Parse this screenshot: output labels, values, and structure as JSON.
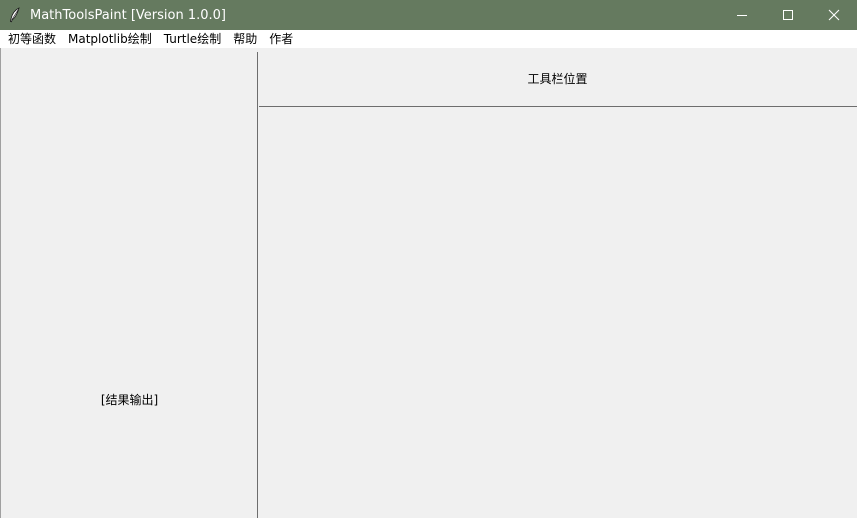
{
  "window": {
    "title": "MathToolsPaint [Version 1.0.0]",
    "app_icon": "feather-icon",
    "controls": {
      "minimize": "minimize-icon",
      "maximize": "maximize-icon",
      "close": "close-icon"
    },
    "colors": {
      "titlebar": "#657a5f",
      "title_text": "#ffffff",
      "menubar": "#ffffff",
      "content_bg": "#f0f0f0"
    }
  },
  "menubar": {
    "items": [
      {
        "label": "初等函数"
      },
      {
        "label": "Matplotlib绘制"
      },
      {
        "label": "Turtle绘制"
      },
      {
        "label": "帮助"
      },
      {
        "label": "作者"
      }
    ]
  },
  "left_panel": {
    "result_label": "[结果输出]"
  },
  "right_panel": {
    "toolbar_label": "工具栏位置"
  }
}
